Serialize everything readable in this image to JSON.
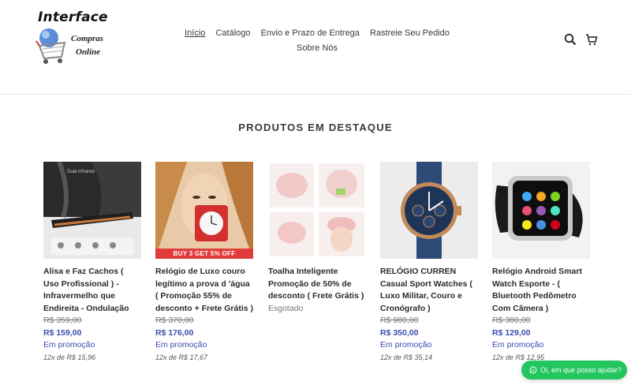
{
  "logo": {
    "title": "Interface",
    "line1": "Compras",
    "line2": "Online"
  },
  "nav": {
    "items": [
      {
        "label": "Início"
      },
      {
        "label": "Catálogo"
      },
      {
        "label": "Envio e Prazo de Entrega"
      },
      {
        "label": "Rastreie Seu Pedido"
      },
      {
        "label": "Sobre Nós"
      }
    ]
  },
  "icons": {
    "search": "search-icon",
    "cart": "cart-icon"
  },
  "section": {
    "title": "PRODUTOS EM DESTAQUE"
  },
  "products": [
    {
      "name": "Alisa e Faz Cachos ( Uso Profissional ) - Infravermelho que Endireita - Ondulação",
      "old_price": "R$ 359,00",
      "price": "R$ 159,00",
      "badge": "Em promoção",
      "installments": "12x de R$ 15,96"
    },
    {
      "name": "Relógio de Luxo couro legítimo a prova d 'água ( Promoção 55% de desconto + Frete Grátis )",
      "old_price": "R$ 370,00",
      "price": "R$ 176,00",
      "badge": "Em promoção",
      "installments": "12x de R$ 17,67",
      "image_text": "BUY 3 GET 5% OFF"
    },
    {
      "name": "Toalha Inteligente Promoção de 50% de desconto ( Frete Grátis )",
      "status": "Esgotado"
    },
    {
      "name": "RELÓGIO CURREN Casual Sport Watches ( Luxo Militar, Couro e Cronógrafo )",
      "old_price": "R$ 980,00",
      "price": "R$ 350,00",
      "badge": "Em promoção",
      "installments": "12x de R$ 35,14"
    },
    {
      "name": "Relógio Android Smart Watch Esporte - ( Bluetooth Pedômetro Com Câmera )",
      "old_price": "R$ 380,00",
      "price": "R$ 129,00",
      "badge": "Em promoção",
      "installments": "12x de R$ 12,95"
    }
  ],
  "whatsapp": {
    "label": "Oi, em que posso ajudar?"
  },
  "colors": {
    "accent": "#3a4cb0",
    "whatsapp": "#22c55e"
  }
}
